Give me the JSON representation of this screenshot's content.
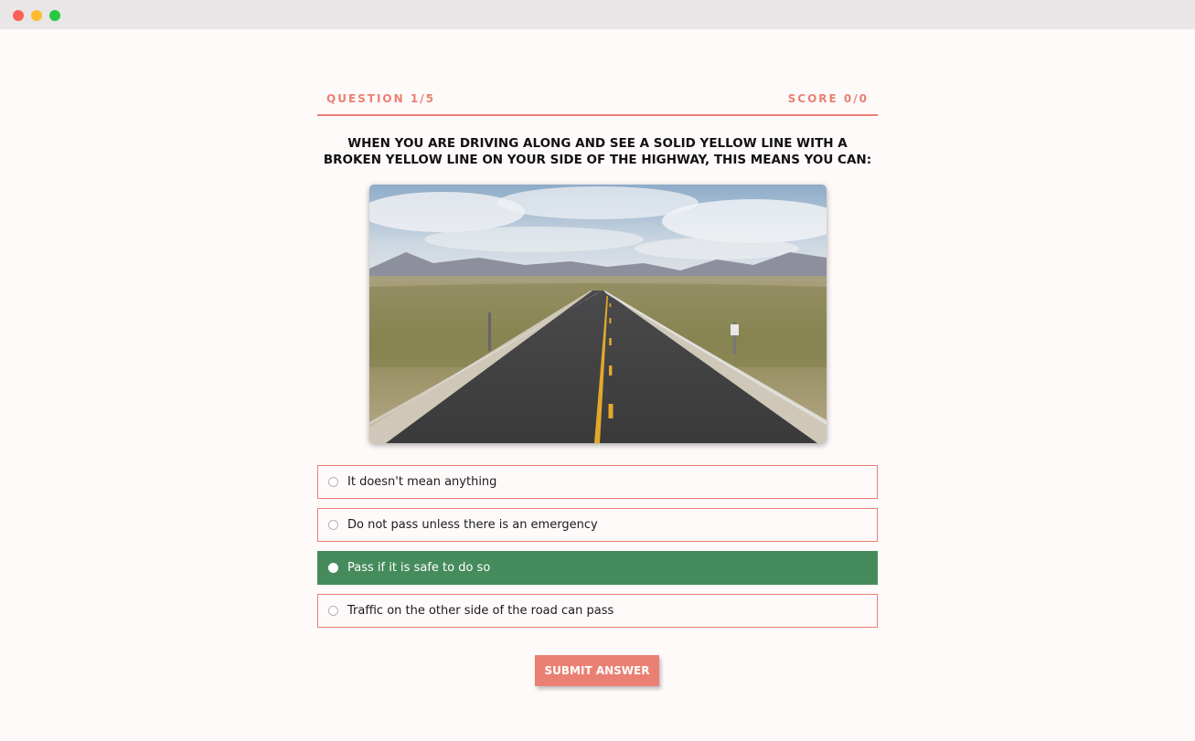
{
  "quiz": {
    "question_counter": "QUESTION 1/5",
    "score": "SCORE 0/0",
    "question": "WHEN YOU ARE DRIVING ALONG AND SEE A SOLID YELLOW LINE WITH A BROKEN YELLOW LINE ON YOUR SIDE OF THE HIGHWAY, THIS MEANS YOU CAN:",
    "image_subject": "desert highway with solid and broken yellow center lines",
    "options": [
      {
        "label": "It doesn't mean anything",
        "selected": false
      },
      {
        "label": "Do not pass unless there is an emergency",
        "selected": false
      },
      {
        "label": "Pass if it is safe to do so",
        "selected": true
      },
      {
        "label": "Traffic on the other side of the road can pass",
        "selected": false
      }
    ],
    "submit_label": "SUBMIT ANSWER"
  },
  "colors": {
    "accent": "#ea8073",
    "selected": "#458b5c",
    "background": "#fffafa"
  }
}
